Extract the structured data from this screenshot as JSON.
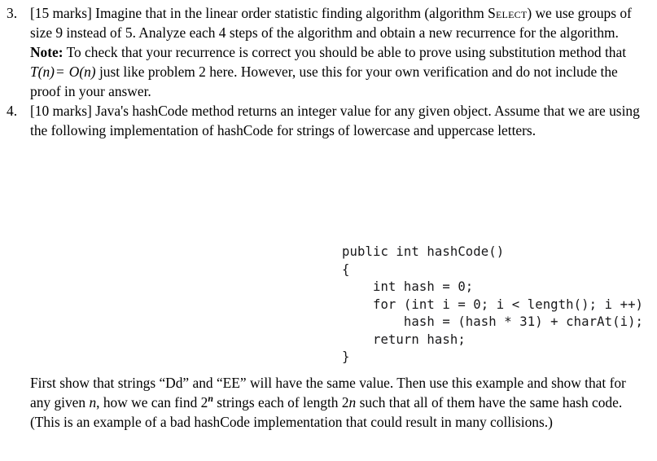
{
  "document": {
    "background_color": "#ffffff",
    "text_color": "#000000",
    "code_color": "#18181a"
  },
  "problems": [
    {
      "number": "3.",
      "paragraphs": [
        {
          "id": "p3a",
          "segments": [
            {
              "type": "text",
              "value": "[15 marks] Imagine that in the linear order statistic finding algorithm (algorithm "
            },
            {
              "type": "smallcaps",
              "value": "Select"
            },
            {
              "type": "text",
              "value": ") we use groups of size 9 instead of 5. Analyze each 4 steps of the algorithm and obtain a new recurrence for the algorithm."
            }
          ],
          "plain": "[15 marks] Imagine that in the linear order statistic finding algorithm (algorithm Select) we use groups of size 9 instead of 5. Analyze each 4 steps of the algorithm and obtain a new recurrence for the algorithm."
        },
        {
          "id": "p3b",
          "note_label": "Note:",
          "before_math": " To check that your recurrence is correct you should be able to prove using substitution method that ",
          "math": {
            "lhs": "T(n)",
            "operator": "=",
            "rhs": "O(n)"
          },
          "after_math": " just like problem 2 here. However, use this for your own verification and do not include the proof in your answer.",
          "plain": "Note: To check that your recurrence is correct you should be able to prove using substitution method that T(n) = O(n) just like problem 2 here. However, use this for your own verification and do not include the proof in your answer."
        }
      ]
    },
    {
      "number": "4.",
      "paragraphs": [
        {
          "id": "p4a",
          "plain": "[10 marks] Java's hashCode method returns an integer value for any given object. Assume that we are using the following implementation of hashCode for strings of lowercase and uppercase letters."
        }
      ]
    }
  ],
  "code_listing": {
    "language": "java",
    "lines": [
      "public int hashCode()",
      "{",
      "    int hash = 0;",
      "    for (int i = 0; i < length(); i ++)",
      "        hash = (hash * 31) + charAt(i);",
      "    return hash;",
      "}"
    ],
    "text": "public int hashCode()\n{\n    int hash = 0;\n    for (int i = 0; i < length(); i ++)\n        hash = (hash * 31) + charAt(i);\n    return hash;\n}"
  },
  "closing_paragraph": {
    "part1": "First show that strings “Dd” and “EE” will have the same value. Then use this example and show that for any given ",
    "var1": "n",
    "part2": ", how we can find 2",
    "exponent": "n",
    "part3": " strings each of length 2",
    "var2": "n",
    "part4": " such that all of them have the same hash code. (This is an example of a bad hashCode implementation that could result in many collisions.)",
    "plain": "First show that strings “Dd” and “EE” will have the same value. Then use this example and show that for any given n, how we can find 2^n strings each of length 2n such that all of them have the same hash code. (This is an example of a bad hashCode implementation that could result in many collisions.)"
  }
}
